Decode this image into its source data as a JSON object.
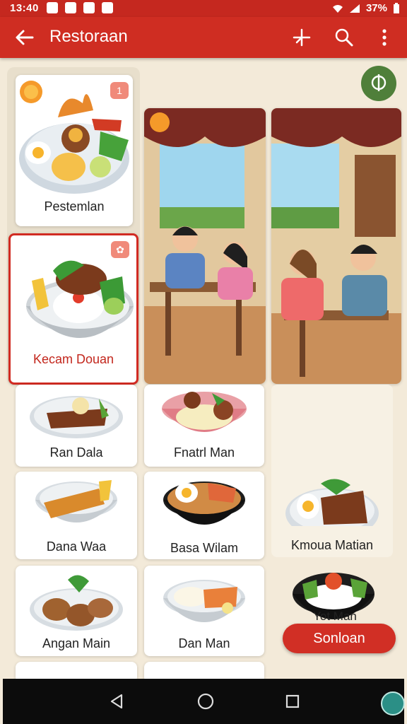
{
  "status_bar": {
    "time": "13:40",
    "battery": "37%"
  },
  "app_bar": {
    "title": "Restoraan"
  },
  "featured": [
    {
      "label": "Pestemlan",
      "badge": "1"
    },
    {
      "label": "Kecam Douan",
      "badge": "✿"
    }
  ],
  "menu_items": [
    {
      "label": "Ran Dala"
    },
    {
      "label": "Fnatrl Man"
    },
    {
      "label": "Dana Waa"
    },
    {
      "label": "Basa Wilam"
    },
    {
      "label": "Kmoua Matian"
    },
    {
      "label": "Angan Main"
    },
    {
      "label": "Dan Man"
    },
    {
      "label": "Yot Man"
    }
  ],
  "pill_button": {
    "label": "Sonloan"
  },
  "colors": {
    "primary": "#cf2d22",
    "fab": "#4f7f3a",
    "background": "#f3ead9"
  }
}
